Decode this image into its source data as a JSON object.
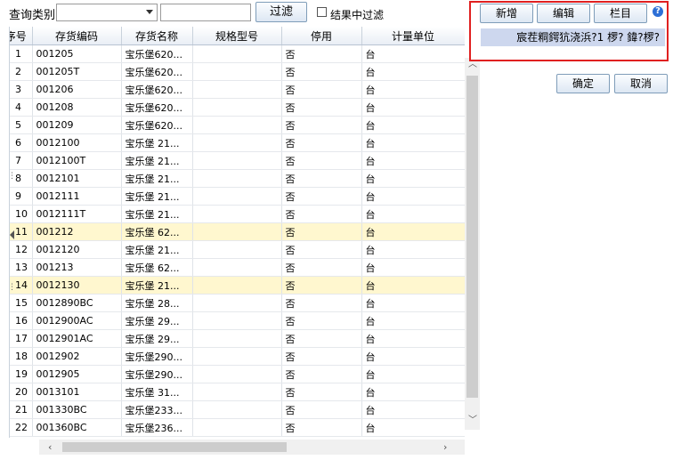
{
  "filter": {
    "query_label": "查询类别",
    "combo_value": "",
    "text_value": "",
    "filter_button": "过滤",
    "in_result_label": "结果中过滤"
  },
  "toolbar": {
    "add": "新增",
    "edit": "编辑",
    "columns": "栏目",
    "help": "?",
    "garbled_text": "宸茬粡鍔犺浇浜?1 椤? 鍏?椤?"
  },
  "dialog": {
    "ok": "确定",
    "cancel": "取消"
  },
  "table": {
    "headers": [
      "序号",
      "存货编码",
      "存货名称",
      "规格型号",
      "停用",
      "计量单位"
    ],
    "rows": [
      [
        "1",
        "001205",
        "宝乐堡620...",
        "",
        "否",
        "台"
      ],
      [
        "2",
        "001205T",
        "宝乐堡620...",
        "",
        "否",
        "台"
      ],
      [
        "3",
        "001206",
        "宝乐堡620...",
        "",
        "否",
        "台"
      ],
      [
        "4",
        "001208",
        "宝乐堡620...",
        "",
        "否",
        "台"
      ],
      [
        "5",
        "001209",
        "宝乐堡620...",
        "",
        "否",
        "台"
      ],
      [
        "6",
        "0012100",
        "宝乐堡 21...",
        "",
        "否",
        "台"
      ],
      [
        "7",
        "0012100T",
        "宝乐堡 21...",
        "",
        "否",
        "台"
      ],
      [
        "8",
        "0012101",
        "宝乐堡 21...",
        "",
        "否",
        "台"
      ],
      [
        "9",
        "0012111",
        "宝乐堡 21...",
        "",
        "否",
        "台"
      ],
      [
        "10",
        "0012111T",
        "宝乐堡 21...",
        "",
        "否",
        "台"
      ],
      [
        "11",
        "001212",
        "宝乐堡 62...",
        "",
        "否",
        "台"
      ],
      [
        "12",
        "0012120",
        "宝乐堡 21...",
        "",
        "否",
        "台"
      ],
      [
        "13",
        "001213",
        "宝乐堡 62...",
        "",
        "否",
        "台"
      ],
      [
        "14",
        "0012130",
        "宝乐堡 21...",
        "",
        "否",
        "台"
      ],
      [
        "15",
        "0012890BC",
        "宝乐堡 28...",
        "",
        "否",
        "台"
      ],
      [
        "16",
        "0012900AC",
        "宝乐堡 29...",
        "",
        "否",
        "台"
      ],
      [
        "17",
        "0012901AC",
        "宝乐堡 29...",
        "",
        "否",
        "台"
      ],
      [
        "18",
        "0012902",
        "宝乐堡290...",
        "",
        "否",
        "台"
      ],
      [
        "19",
        "0012905",
        "宝乐堡290...",
        "",
        "否",
        "台"
      ],
      [
        "20",
        "0013101",
        "宝乐堡 31...",
        "",
        "否",
        "台"
      ],
      [
        "21",
        "001330BC",
        "宝乐堡233...",
        "",
        "否",
        "台"
      ],
      [
        "22",
        "001360BC",
        "宝乐堡236...",
        "",
        "否",
        "台"
      ]
    ],
    "highlighted_rows": [
      "11",
      "14"
    ]
  },
  "scroll_icons": {
    "up": "chevron-up-icon",
    "down": "chevron-down-icon",
    "left": "chevron-left-icon",
    "right": "chevron-right-icon"
  },
  "colors": {
    "highlight_row": "#fff7cf",
    "panel_border": "#e02020",
    "garbled_bg": "#cdd7ee"
  }
}
